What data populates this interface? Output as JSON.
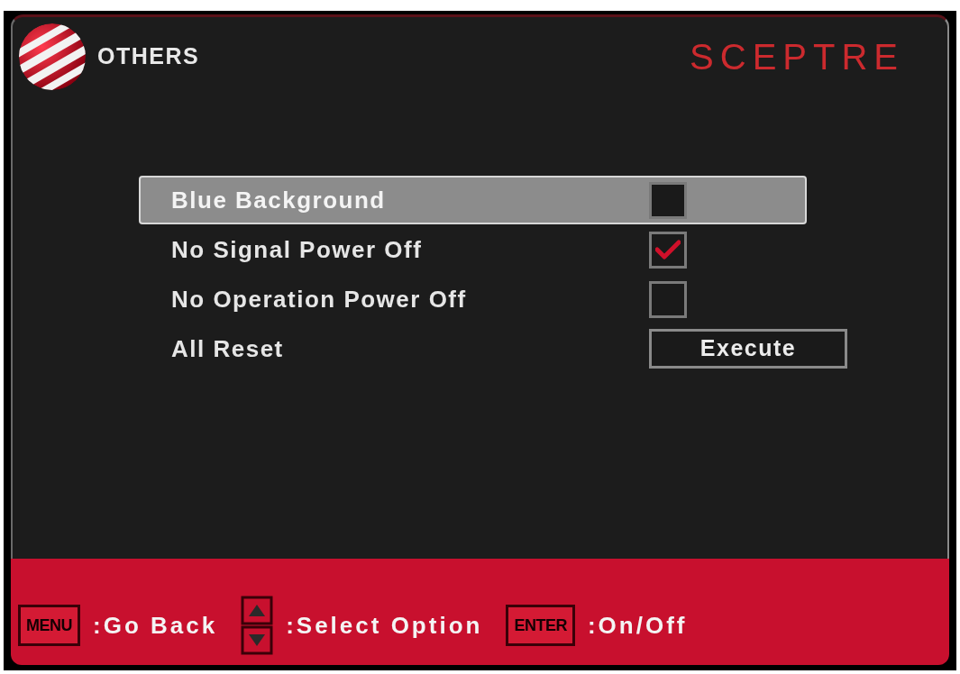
{
  "header": {
    "title": "OTHERS",
    "brand": "SCEPTRE"
  },
  "options": [
    {
      "label": "Blue Background",
      "kind": "checkbox",
      "checked": false,
      "selected": true
    },
    {
      "label": "No Signal Power Off",
      "kind": "checkbox",
      "checked": true,
      "selected": false
    },
    {
      "label": "No Operation Power Off",
      "kind": "checkbox",
      "checked": false,
      "selected": false
    },
    {
      "label": "All Reset",
      "kind": "button",
      "button": "Execute",
      "selected": false
    }
  ],
  "footer": {
    "hints": [
      {
        "kind": "key",
        "key": "MENU",
        "label": ":Go Back"
      },
      {
        "kind": "arrows",
        "label": ":Select Option"
      },
      {
        "kind": "key",
        "key": "ENTER",
        "label": ":On/Off"
      }
    ]
  }
}
